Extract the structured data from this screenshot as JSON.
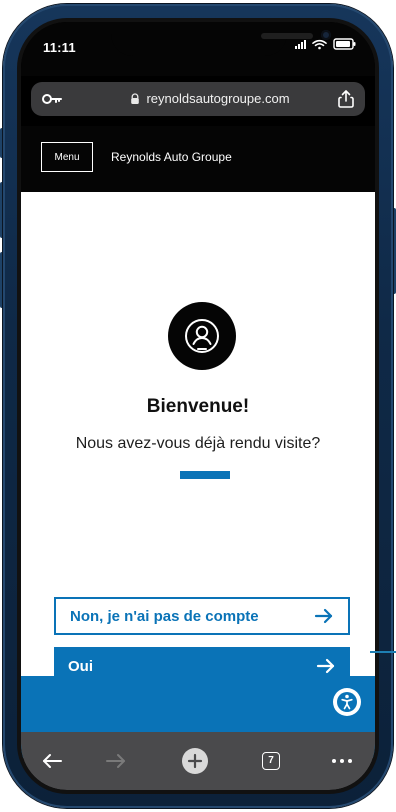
{
  "status_bar": {
    "time": "11:11"
  },
  "browser": {
    "url": "reynoldsautogroupe.com",
    "tab_count": "7"
  },
  "site_header": {
    "menu_label": "Menu",
    "brand_name": "Reynolds Auto Groupe"
  },
  "main": {
    "title": "Bienvenue!",
    "subtitle": "Nous avez-vous déjà rendu visite?",
    "no_account_button": "Non, je n'ai pas de compte",
    "yes_button": "Oui"
  },
  "icons": {
    "signal": "signal-icon",
    "wifi": "wifi-icon",
    "battery": "battery-icon",
    "key": "key-icon",
    "lock": "lock-icon",
    "share": "share-icon",
    "user": "user-circle-icon",
    "arrow_right": "arrow-right-icon",
    "accessibility": "accessibility-icon",
    "back": "back-arrow-icon",
    "forward": "forward-arrow-icon",
    "new_tab": "plus-icon",
    "tabs": "tabs-icon",
    "more": "more-icon"
  },
  "colors": {
    "primary_blue": "#0a73b7",
    "header_black": "#050505",
    "toolbar_gray": "#4a4a4c"
  }
}
